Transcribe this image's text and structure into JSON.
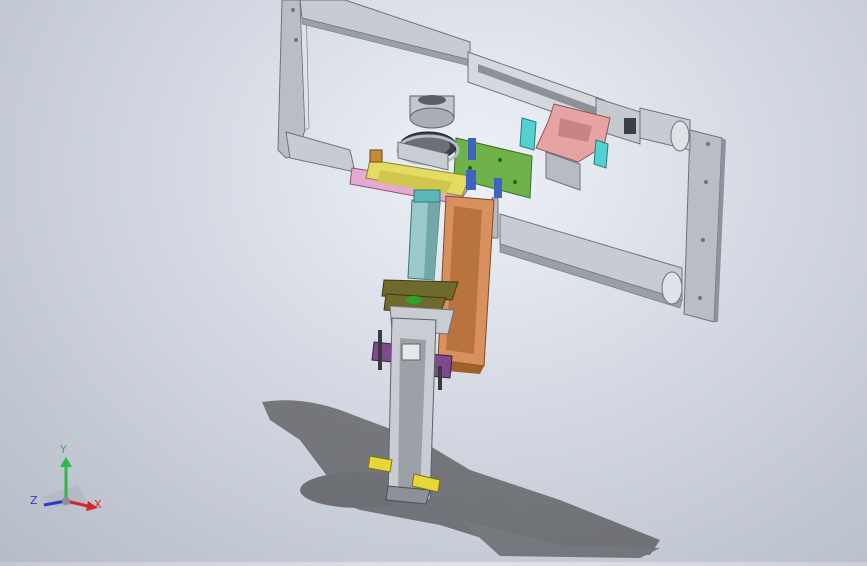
{
  "view": {
    "background": "#c7ccd6"
  },
  "colors": {
    "frame": "#b9bec6",
    "frame_dark": "#8d939c",
    "frame_light": "#dfe2e6",
    "rail": "#c8ccd2",
    "bracket_green": "#6fb24a",
    "bracket_pink": "#e6a3a3",
    "column_teal": "#9bc9c9",
    "plate_pink": "#e4aacf",
    "plate_yellow": "#e3db62",
    "copper": "#d8915e",
    "olive": "#6d6a2c",
    "purple": "#7d4a8e",
    "gripper_yellow": "#e7d83a",
    "blue_block": "#3f64c0",
    "cyan_block": "#53d0d0",
    "shadow": "#1a1a1a"
  },
  "triad": {
    "x_label": "X",
    "y_label": "Y",
    "z_label": "Z",
    "x_color": "#d7252b",
    "y_color": "#2db84a",
    "z_color": "#2c3cc8"
  }
}
